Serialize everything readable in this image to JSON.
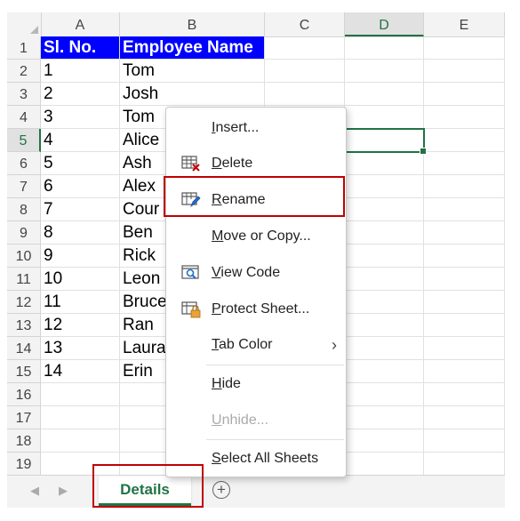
{
  "columns": [
    "A",
    "B",
    "C",
    "D",
    "E"
  ],
  "selected_column": "D",
  "selected_row": "5",
  "rows": [
    "1",
    "2",
    "3",
    "4",
    "5",
    "6",
    "7",
    "8",
    "9",
    "10",
    "11",
    "12",
    "13",
    "14",
    "15",
    "16",
    "17",
    "18",
    "19"
  ],
  "table": {
    "headers": [
      "Sl. No.",
      "Employee Name"
    ],
    "data": [
      [
        "1",
        "Tom"
      ],
      [
        "2",
        "Josh"
      ],
      [
        "3",
        "Tom"
      ],
      [
        "4",
        "Alice"
      ],
      [
        "5",
        "Ash"
      ],
      [
        "6",
        "Alex"
      ],
      [
        "7",
        "Cour"
      ],
      [
        "8",
        "Ben"
      ],
      [
        "9",
        "Rick"
      ],
      [
        "10",
        "Leon"
      ],
      [
        "11",
        "Bruce"
      ],
      [
        "12",
        "Ran"
      ],
      [
        "13",
        "Laura"
      ],
      [
        "14",
        "Erin"
      ]
    ]
  },
  "sheet_tab": {
    "label": "Details"
  },
  "nav": {
    "prev": "◀",
    "next": "▶",
    "add": "+"
  },
  "context_menu": {
    "insert": {
      "u": "I",
      "rest": "nsert..."
    },
    "delete": {
      "u": "D",
      "rest": "elete"
    },
    "rename": {
      "u": "R",
      "rest": "ename"
    },
    "move_copy": {
      "u": "M",
      "rest": "ove or Copy..."
    },
    "view_code": {
      "u": "V",
      "rest": "iew Code"
    },
    "protect": {
      "u": "P",
      "rest": "rotect Sheet..."
    },
    "tab_color": {
      "u": "T",
      "rest": "ab Color"
    },
    "hide": {
      "u": "H",
      "rest": "ide"
    },
    "unhide": {
      "u": "U",
      "rest": "nhide..."
    },
    "select_all": {
      "u": "S",
      "rest": "elect All Sheets"
    },
    "submenu_arrow": "›"
  },
  "colors": {
    "accent": "#217346",
    "highlight": "#c00000",
    "header_fill": "#0000ff"
  },
  "icons": {
    "delete": "delete-sheet-icon",
    "rename": "rename-sheet-icon",
    "view_code": "view-code-icon",
    "protect": "protect-sheet-icon"
  }
}
